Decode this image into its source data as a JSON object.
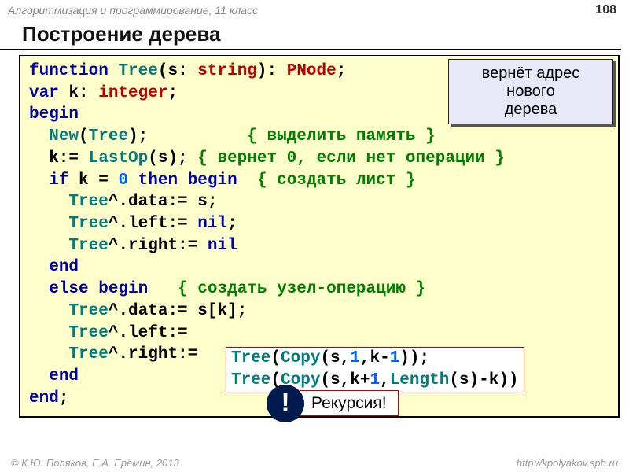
{
  "header": {
    "course": "Алгоритмизация и программирование, 11 класс",
    "page": "108"
  },
  "title": "Построение дерева",
  "callout": {
    "l1": "вернёт адрес",
    "l2": "нового",
    "l3": "дерева"
  },
  "code": {
    "l1_fn": "function",
    "l1_tree": "Tree",
    "l1_s": "(s: ",
    "l1_str": "string",
    "l1_close": "): ",
    "l1_pnode": "PNode",
    "l1_semi": ";",
    "l2_var": "var",
    "l2_k": " k: ",
    "l2_int": "integer",
    "l2_semi": ";",
    "l3_begin": "begin",
    "l4_new": "New",
    "l4_tree": "Tree",
    "l4_cm": "{ выделить память }",
    "l5_lastop": "LastOp",
    "l5_cm": "{ вернет 0, если нет операции }",
    "l6_if": "if",
    "l6_then": "then",
    "l6_begin": "begin",
    "l6_zero": "0",
    "l6_cm": "{ создать лист }",
    "l7_tree": "Tree",
    "l8_tree": "Tree",
    "l8_nil": "nil",
    "l9_tree": "Tree",
    "l9_nil": "nil",
    "l10_end": "end",
    "l11_else": "else",
    "l11_begin": "begin",
    "l11_cm": "{ создать узел-операцию }",
    "l12_tree": "Tree",
    "l13_tree": "Tree",
    "l14_tree": "Tree",
    "l15_end": "end",
    "l16_end": "end"
  },
  "boxed": {
    "tree1": "Tree",
    "copy1": "Copy",
    "one1": "1",
    "one2": "1",
    "tree2": "Tree",
    "copy2": "Copy",
    "one3": "1",
    "len": "Length"
  },
  "badge": {
    "mark": "!",
    "text": "Рекурсия!"
  },
  "footer": {
    "left": "© К.Ю. Поляков, Е.А. Ерёмин, 2013",
    "right": "http://kpolyakov.spb.ru"
  }
}
